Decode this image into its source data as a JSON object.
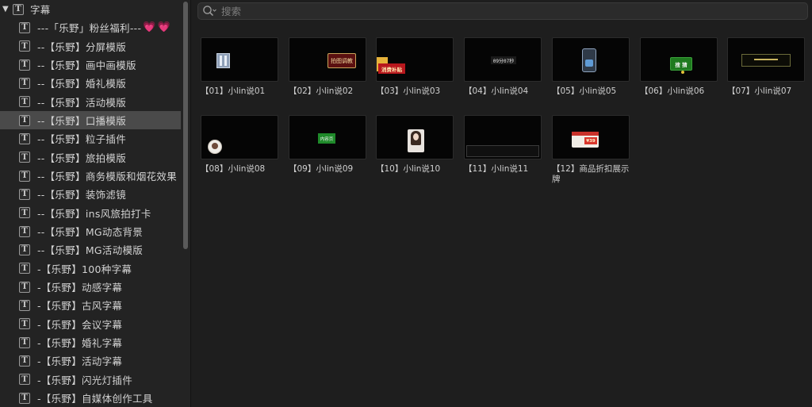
{
  "sidebar": {
    "root": {
      "label": "字幕",
      "expanded": true
    },
    "items": [
      {
        "label": "---「乐野」粉丝福利---",
        "hearts": "💗💗"
      },
      {
        "label": "--【乐野】分屏模版"
      },
      {
        "label": "--【乐野】画中画模版"
      },
      {
        "label": "--【乐野】婚礼模版"
      },
      {
        "label": "--【乐野】活动模版"
      },
      {
        "label": "--【乐野】口播模版",
        "selected": true
      },
      {
        "label": "--【乐野】粒子插件"
      },
      {
        "label": "--【乐野】旅拍模版"
      },
      {
        "label": "--【乐野】商务模版和烟花效果"
      },
      {
        "label": "--【乐野】装饰滤镜"
      },
      {
        "label": "--【乐野】ins风旅拍打卡"
      },
      {
        "label": "--【乐野】MG动态背景"
      },
      {
        "label": "--【乐野】MG活动模版"
      },
      {
        "label": "-【乐野】100种字幕"
      },
      {
        "label": "-【乐野】动感字幕"
      },
      {
        "label": "-【乐野】古风字幕"
      },
      {
        "label": "-【乐野】会议字幕"
      },
      {
        "label": "-【乐野】婚礼字幕"
      },
      {
        "label": "-【乐野】活动字幕"
      },
      {
        "label": "-【乐野】闪光灯插件"
      },
      {
        "label": "-【乐野】自媒体创作工具"
      }
    ],
    "type_icon": "T"
  },
  "search": {
    "placeholder": "搜索",
    "value": ""
  },
  "tiles": [
    {
      "caption": "【01】小lin说01",
      "thumb": {
        "text": ""
      }
    },
    {
      "caption": "【02】小lin说02",
      "thumb": {
        "text": "拍图调教"
      }
    },
    {
      "caption": "【03】小lin说03",
      "thumb": {
        "text": "消费补贴"
      }
    },
    {
      "caption": "【04】小lin说04",
      "thumb": {
        "text": "09分07秒"
      }
    },
    {
      "caption": "【05】小lin说05",
      "thumb": {
        "text": ""
      }
    },
    {
      "caption": "【06】小lin说06",
      "thumb": {
        "text": "搜 猜"
      }
    },
    {
      "caption": "【07】小lin说07",
      "thumb": {
        "text": ""
      }
    },
    {
      "caption": "【08】小lin说08",
      "thumb": {
        "text": ""
      }
    },
    {
      "caption": "【09】小lin说09",
      "thumb": {
        "text": "内容页"
      }
    },
    {
      "caption": "【10】小lin说10",
      "thumb": {
        "text": ""
      }
    },
    {
      "caption": "【11】小lin说11",
      "thumb": {
        "text": ""
      }
    },
    {
      "caption": "【12】商品折扣展示牌",
      "thumb": {
        "text": "¥39"
      }
    }
  ],
  "colors": {
    "selection": "#4a4a4a",
    "hearts": "#f06bb5",
    "thumb_bg": "#050505"
  },
  "icons": [
    "disclosure-triangle-icon",
    "title-type-icon",
    "search-icon"
  ]
}
